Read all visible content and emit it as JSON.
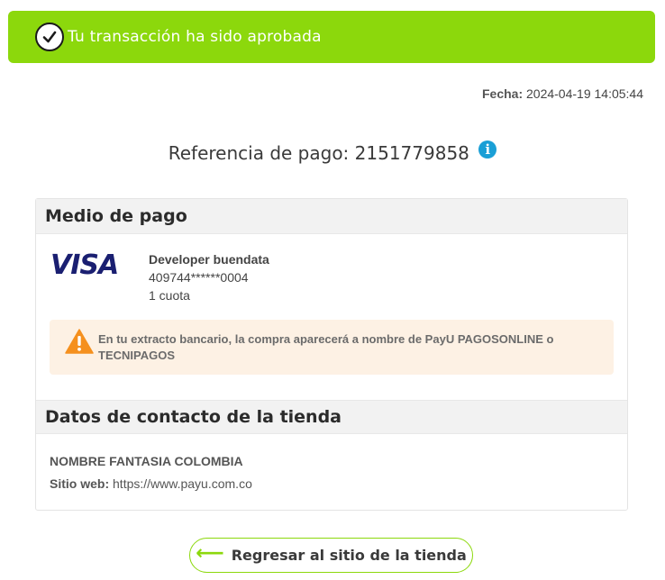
{
  "banner": {
    "title": "Tu transacción ha sido aprobada",
    "icon": "check-circle-icon",
    "color": "#8cd80c"
  },
  "transaction": {
    "date_label": "Fecha:",
    "date_value": "2024-04-19  14:05:44",
    "reference_label": "Referencia de pago: 2151779858",
    "info_icon": "info-icon"
  },
  "payment": {
    "section_title": "Medio de pago",
    "brand": "VISA",
    "holder": "Developer buendata",
    "card_number": "409744******0004",
    "installments": "1 cuota",
    "warning_icon": "warning-icon",
    "warning_text": "En tu extracto bancario, la compra aparecerá a nombre de PayU PAGOSONLINE o TECNIPAGOS"
  },
  "store": {
    "section_title": "Datos de contacto de la tienda",
    "name": "NOMBRE FANTASIA COLOMBIA",
    "web_label": "Sitio web:",
    "web_value": "https://www.payu.com.co"
  },
  "actions": {
    "back_label": "Regresar al sitio de la tienda",
    "back_icon": "arrow-left-icon"
  }
}
